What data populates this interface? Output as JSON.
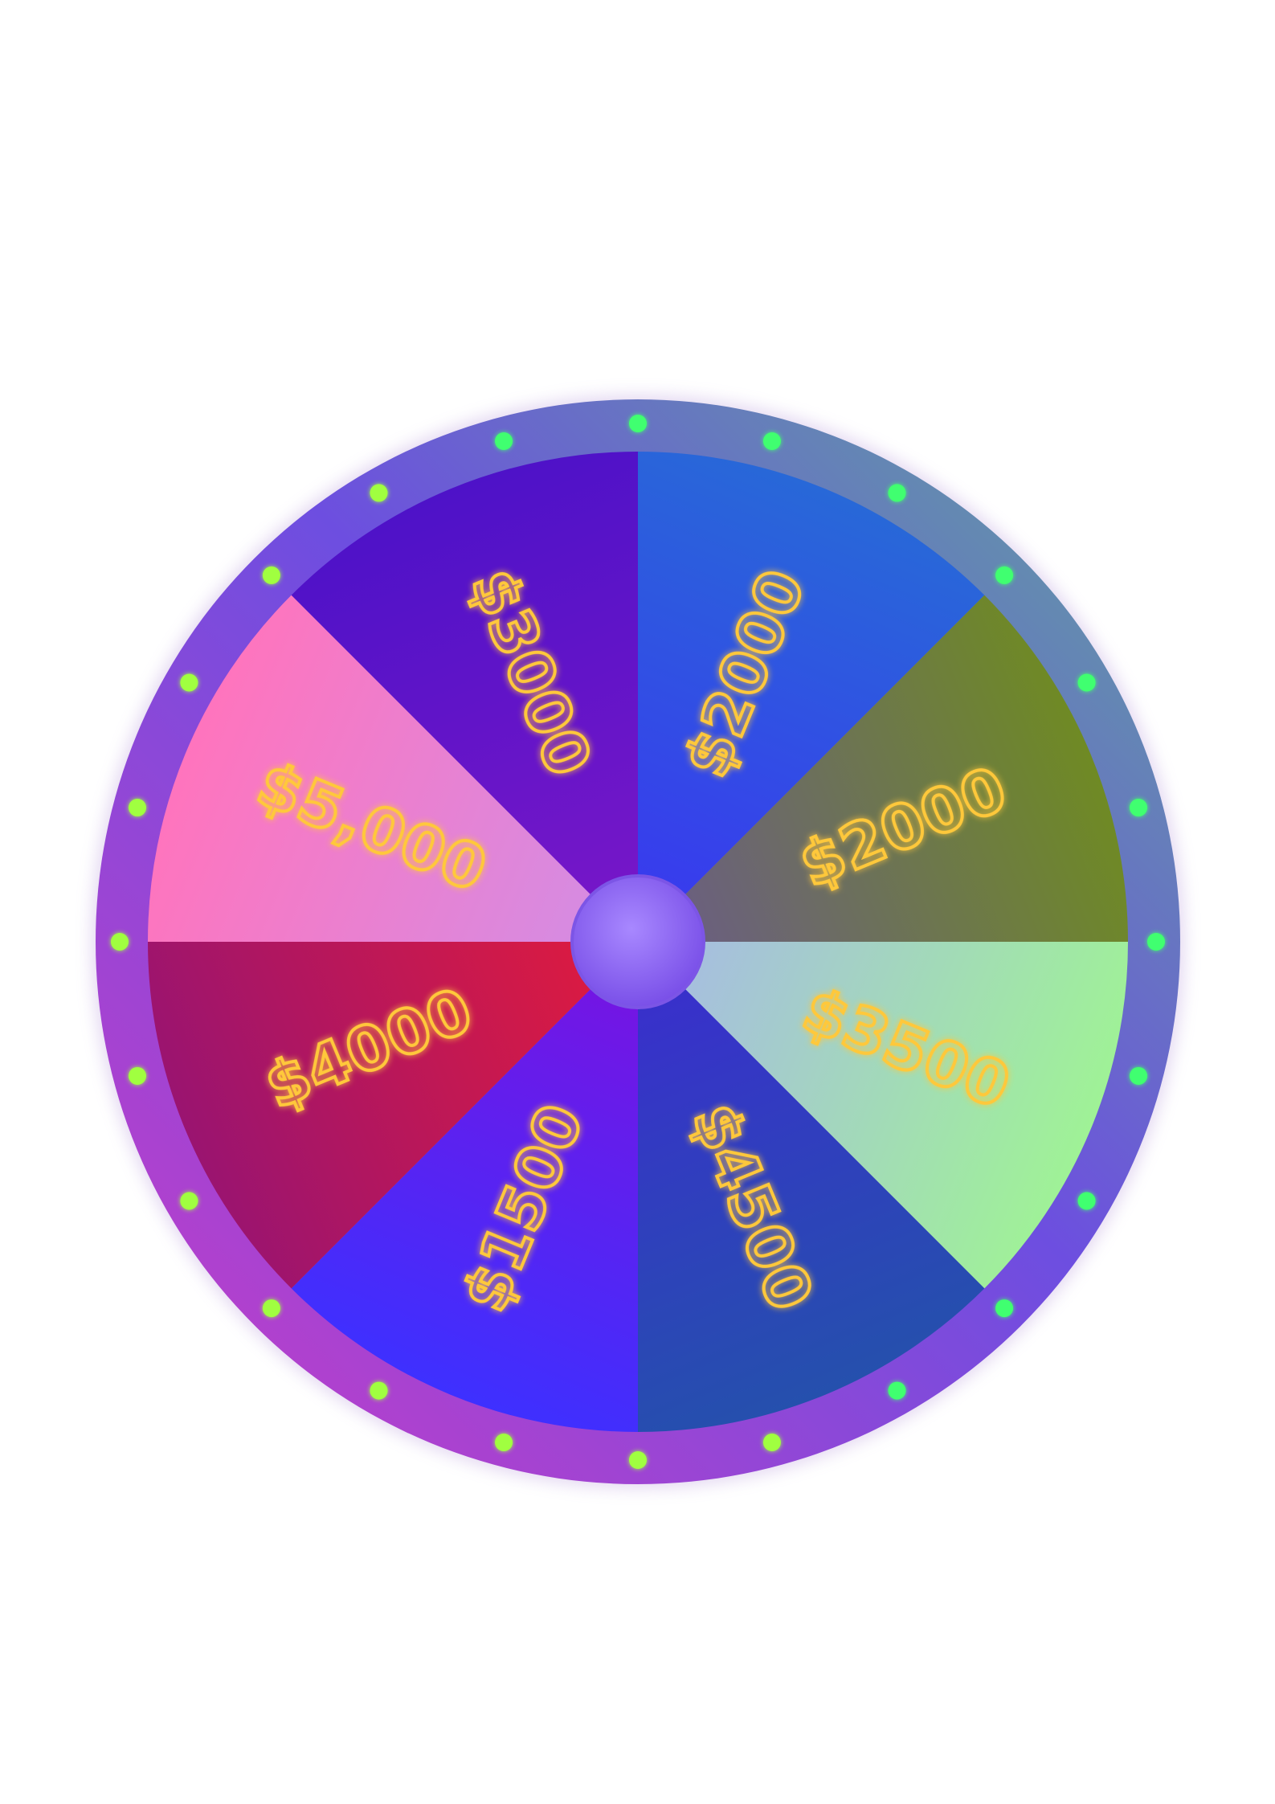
{
  "wheel": {
    "segments": [
      {
        "label": "$2000",
        "color_start": "#2868d8",
        "color_end": "#3a36f0"
      },
      {
        "label": "$2000",
        "color_start": "#6f8a24",
        "color_end": "#6a5a8a"
      },
      {
        "label": "$3500",
        "color_start": "#9ff296",
        "color_end": "#a7b8e8"
      },
      {
        "label": "$4500",
        "color_start": "#2550ad",
        "color_end": "#3b2ccf"
      },
      {
        "label": "$1500",
        "color_start": "#3e30ff",
        "color_end": "#7a12e0"
      },
      {
        "label": "$4000",
        "color_start": "#9a1470",
        "color_end": "#e21b3c"
      },
      {
        "label": "$5,000",
        "color_start": "#ff74bd",
        "color_end": "#d18ee6"
      },
      {
        "label": "$3000",
        "color_start": "#4e12c8",
        "color_end": "#7a17c8"
      }
    ],
    "rim_colors": [
      "#5aa4a0",
      "#7a3ce0",
      "#c13ecf"
    ],
    "bulb_colors": [
      "#40ff70",
      "#a0ff40"
    ],
    "hub_color": "#8a5cf0",
    "label_color": "#ffc83a"
  }
}
